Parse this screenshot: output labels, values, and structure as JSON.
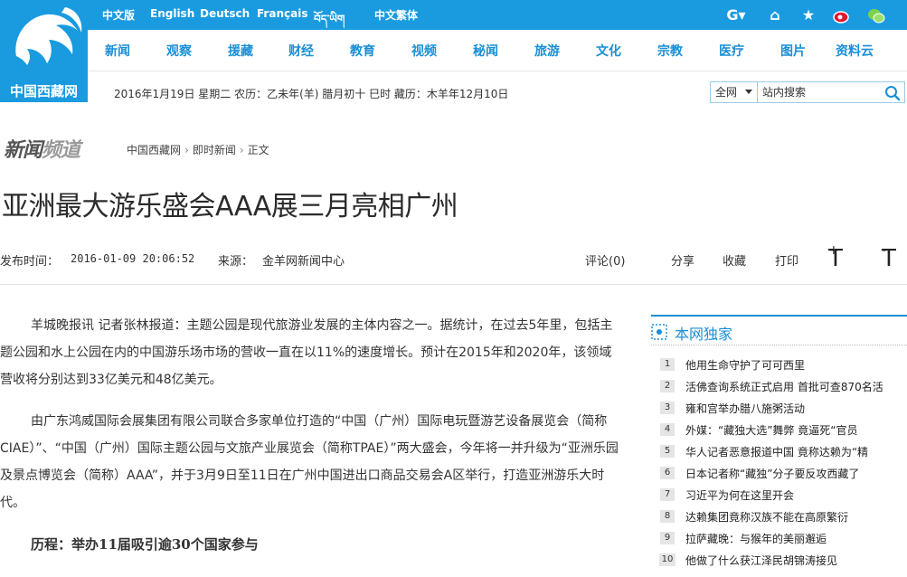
{
  "site": {
    "logo_text": "中国西藏网"
  },
  "topbar": {
    "languages": [
      "中文版",
      "English",
      "Deutsch",
      "Français",
      "བོད་ཡིག",
      "中文繁体"
    ]
  },
  "nav": {
    "items": [
      "新闻",
      "观察",
      "援藏",
      "财经",
      "教育",
      "视频",
      "秘闻",
      "旅游",
      "文化",
      "宗教",
      "医疗",
      "图片",
      "资料云"
    ]
  },
  "dateline": "2016年1月19日 星期二 农历：乙未年(羊) 腊月初十 巳时 藏历：木羊年12月10日",
  "search": {
    "scope": "全网",
    "placeholder": "站内搜索"
  },
  "channel": {
    "name_a": "新闻",
    "name_b": "频道"
  },
  "breadcrumb": [
    "中国西藏网",
    "即时新闻",
    "正文"
  ],
  "article": {
    "title": "亚洲最大游乐盛会AAA展三月亮相广州",
    "publish_label": "发布时间：",
    "publish_time": "2016-01-09 20:06:52",
    "source_label": "来源：",
    "source": "金羊网新闻中心",
    "comment": "评论(0)",
    "share": "分享",
    "favorite": "收藏",
    "print": "打印",
    "font_up": "T",
    "font_up_sign": "+",
    "font_down": "T",
    "font_down_sign": "-",
    "paragraphs": [
      "羊城晚报讯 记者张林报道：主题公园是现代旅游业发展的主体内容之一。据统计，在过去5年里，包括主题公园和水上公园在内的中国游乐场市场的营收一直在以11%的速度增长。预计在2015年和2020年，该领域营收将分别达到33亿美元和48亿美元。",
      "由广东鸿威国际会展集团有限公司联合多家单位打造的“中国（广州）国际电玩暨游艺设备展览会（简称CIAE）”、“中国（广州）国际主题公园与文旅产业展览会（简称TPAE）”两大盛会，今年将一并升级为“亚洲乐园及景点博览会（简称）AAA”，并于3月9日至11日在广州中国进出口商品交易会A区举行，打造亚洲游乐大时代。"
    ],
    "subheading": "历程：举办11届吸引逾30个国家参与"
  },
  "sidebar": {
    "title": "本网独家",
    "items": [
      {
        "num": "1",
        "text": "他用生命守护了可可西里"
      },
      {
        "num": "2",
        "text": "活佛查询系统正式启用 首批可查870名活"
      },
      {
        "num": "3",
        "text": "雍和宫举办腊八施粥活动"
      },
      {
        "num": "4",
        "text": "外媒：“藏独大选”舞弊 竟逼死“官员"
      },
      {
        "num": "5",
        "text": "华人记者恶意报道中国 竟称达赖为“精"
      },
      {
        "num": "6",
        "text": "日本记者称“藏独”分子要反攻西藏了"
      },
      {
        "num": "7",
        "text": "习近平为何在这里开会"
      },
      {
        "num": "8",
        "text": "达赖集团竟称汉族不能在高原繁衍"
      },
      {
        "num": "9",
        "text": "拉萨藏晚：与猴年的美丽邂逅"
      },
      {
        "num": "10",
        "text": "他做了什么获江泽民胡锦涛接见"
      }
    ]
  },
  "colors": {
    "brand": "#1a9be0",
    "nav_text": "#1a8fd6"
  }
}
